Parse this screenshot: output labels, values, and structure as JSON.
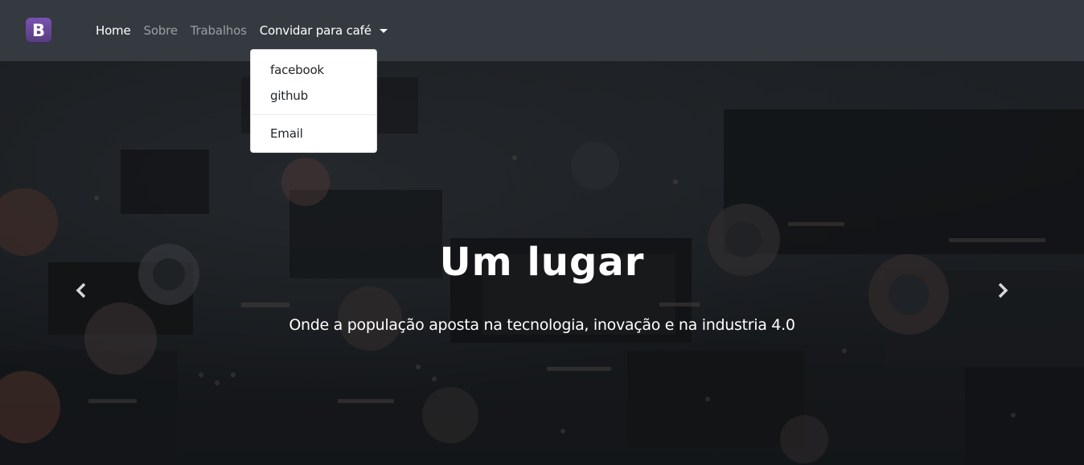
{
  "navbar": {
    "brand_letter": "B",
    "brand_colors": {
      "top": "#7952b3",
      "bottom": "#563d7c"
    },
    "background": "#343a40",
    "links": [
      {
        "label": "Home",
        "state": "active"
      },
      {
        "label": "Sobre",
        "state": "muted"
      },
      {
        "label": "Trabalhos",
        "state": "muted"
      }
    ],
    "dropdown": {
      "label": "Convidar para café",
      "open": true,
      "items": [
        "facebook",
        "github"
      ],
      "after_divider": [
        "Email"
      ]
    }
  },
  "carousel": {
    "title": "Um lugar",
    "text": "Onde a população aposta na tecnologia, inovação e na industria 4.0",
    "prev_icon": "chevron-left-icon",
    "next_icon": "chevron-right-icon",
    "background_image": "circuit-board-photo"
  }
}
